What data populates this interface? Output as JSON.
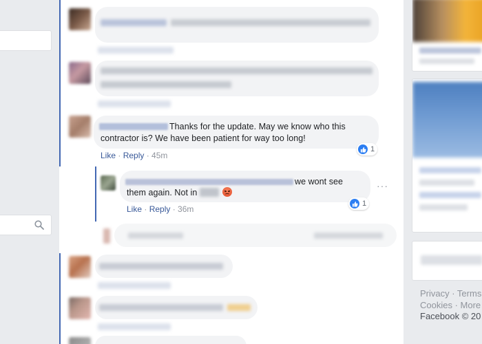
{
  "comments": [
    {
      "text": "Thanks for the update. May we know who this contractor is? We have been patient for way too long!",
      "line1": "Thanks for the update. May we know who this",
      "line2": "contractor is? We have been patient for way too long!",
      "like": "Like",
      "reply": "Reply",
      "time": "45m",
      "reaction_count": "1"
    }
  ],
  "reply": {
    "line1": "we wont see",
    "line2": "them again. Not in",
    "like": "Like",
    "reply": "Reply",
    "time": "36m",
    "reaction_count": "1",
    "more": "···"
  },
  "footer": {
    "line1": "Privacy · Terms",
    "line2": "Cookies · More",
    "copyright": "Facebook © 20"
  },
  "icons": {
    "search": "search-icon",
    "like": "like-reaction-icon",
    "angry": "angry-emoji-icon",
    "more": "more-options-icon"
  },
  "colors": {
    "link": "#385898",
    "thread_bar": "#4267b2",
    "like_blue": "#2c7ef2",
    "bubble": "#f2f3f5"
  }
}
